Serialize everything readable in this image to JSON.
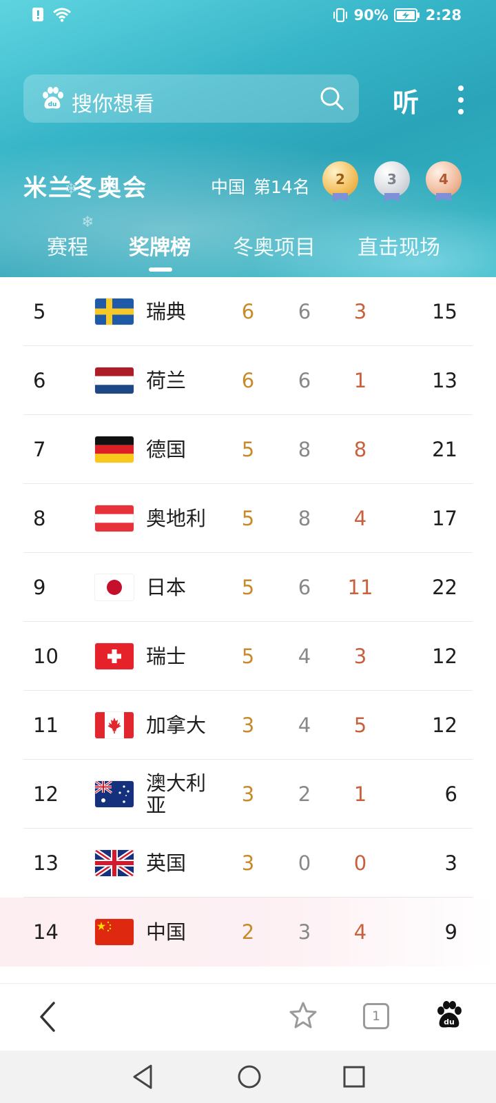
{
  "status": {
    "battery": "90%",
    "time": "2:28"
  },
  "search": {
    "placeholder": "搜你想看",
    "listen_label": "听"
  },
  "event": {
    "title": "米兰冬奥会",
    "country": "中国",
    "rank": "第14名",
    "medals": {
      "gold": "2",
      "silver": "3",
      "bronze": "4"
    }
  },
  "tabs": [
    {
      "label": "赛程",
      "active": false
    },
    {
      "label": "奖牌榜",
      "active": true
    },
    {
      "label": "冬奥项目",
      "active": false
    },
    {
      "label": "直击现场",
      "active": false
    }
  ],
  "table": {
    "rows": [
      {
        "rank": "5",
        "country": "瑞典",
        "flag": "sweden-flag",
        "gold": "6",
        "silver": "6",
        "bronze": "3",
        "total": "15"
      },
      {
        "rank": "6",
        "country": "荷兰",
        "flag": "netherlands-flag",
        "gold": "6",
        "silver": "6",
        "bronze": "1",
        "total": "13"
      },
      {
        "rank": "7",
        "country": "德国",
        "flag": "germany-flag",
        "gold": "5",
        "silver": "8",
        "bronze": "8",
        "total": "21"
      },
      {
        "rank": "8",
        "country": "奥地利",
        "flag": "austria-flag",
        "gold": "5",
        "silver": "8",
        "bronze": "4",
        "total": "17"
      },
      {
        "rank": "9",
        "country": "日本",
        "flag": "japan-flag",
        "gold": "5",
        "silver": "6",
        "bronze": "11",
        "total": "22"
      },
      {
        "rank": "10",
        "country": "瑞士",
        "flag": "switzerland-flag",
        "gold": "5",
        "silver": "4",
        "bronze": "3",
        "total": "12"
      },
      {
        "rank": "11",
        "country": "加拿大",
        "flag": "canada-flag",
        "gold": "3",
        "silver": "4",
        "bronze": "5",
        "total": "12"
      },
      {
        "rank": "12",
        "country": "澳大利亚",
        "flag": "australia-flag",
        "gold": "3",
        "silver": "2",
        "bronze": "1",
        "total": "6"
      },
      {
        "rank": "13",
        "country": "英国",
        "flag": "uk-flag",
        "gold": "3",
        "silver": "0",
        "bronze": "0",
        "total": "3"
      },
      {
        "rank": "14",
        "country": "中国",
        "flag": "china-flag",
        "gold": "2",
        "silver": "3",
        "bronze": "4",
        "total": "9",
        "highlight": true
      }
    ]
  },
  "bottom_bar": {
    "tab_count": "1"
  },
  "colors": {
    "gold_text": "#c88a2a",
    "silver_text": "#888888",
    "bronze_text": "#c8603d",
    "header_teal": "#37b5c8"
  }
}
